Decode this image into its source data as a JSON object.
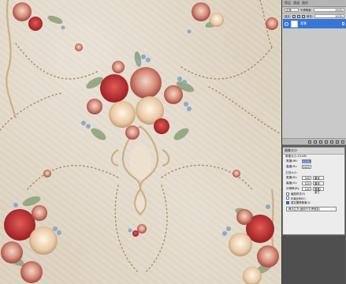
{
  "layers_panel": {
    "tabs": [
      "图层",
      "通道",
      "路径"
    ],
    "blend_mode": "正常",
    "opacity_label": "不透明度:",
    "opacity_value": "100%",
    "lock_label": "锁定:",
    "fill_label": "填充:",
    "fill_value": "100%",
    "layer_name": "背景"
  },
  "image_size_dialog": {
    "title": "图像大小",
    "pixel_dims": "像素大小:23.6M",
    "width_label": "宽度(W):",
    "width_value": "4200",
    "height_label": "高度(H):",
    "height_value": "5420",
    "doc_size": "文档大小:",
    "doc_width_label": "宽度(D):",
    "doc_width_value": "300",
    "doc_height_label": "高度(G):",
    "doc_height_value": "320",
    "resolution_label": "分辨率(R):",
    "resolution_value": "140",
    "unit_cm": "厘米",
    "unit_ppi": "像素/英寸",
    "scale_styles": "缩放样式(Y)",
    "constrain": "约束比例(C)",
    "resample": "重定图像像素(I):",
    "method": "两次立方(适用于平滑渐变)"
  },
  "colors": {
    "selection": "#3875d7",
    "panel_bg": "#c9c9c9"
  }
}
